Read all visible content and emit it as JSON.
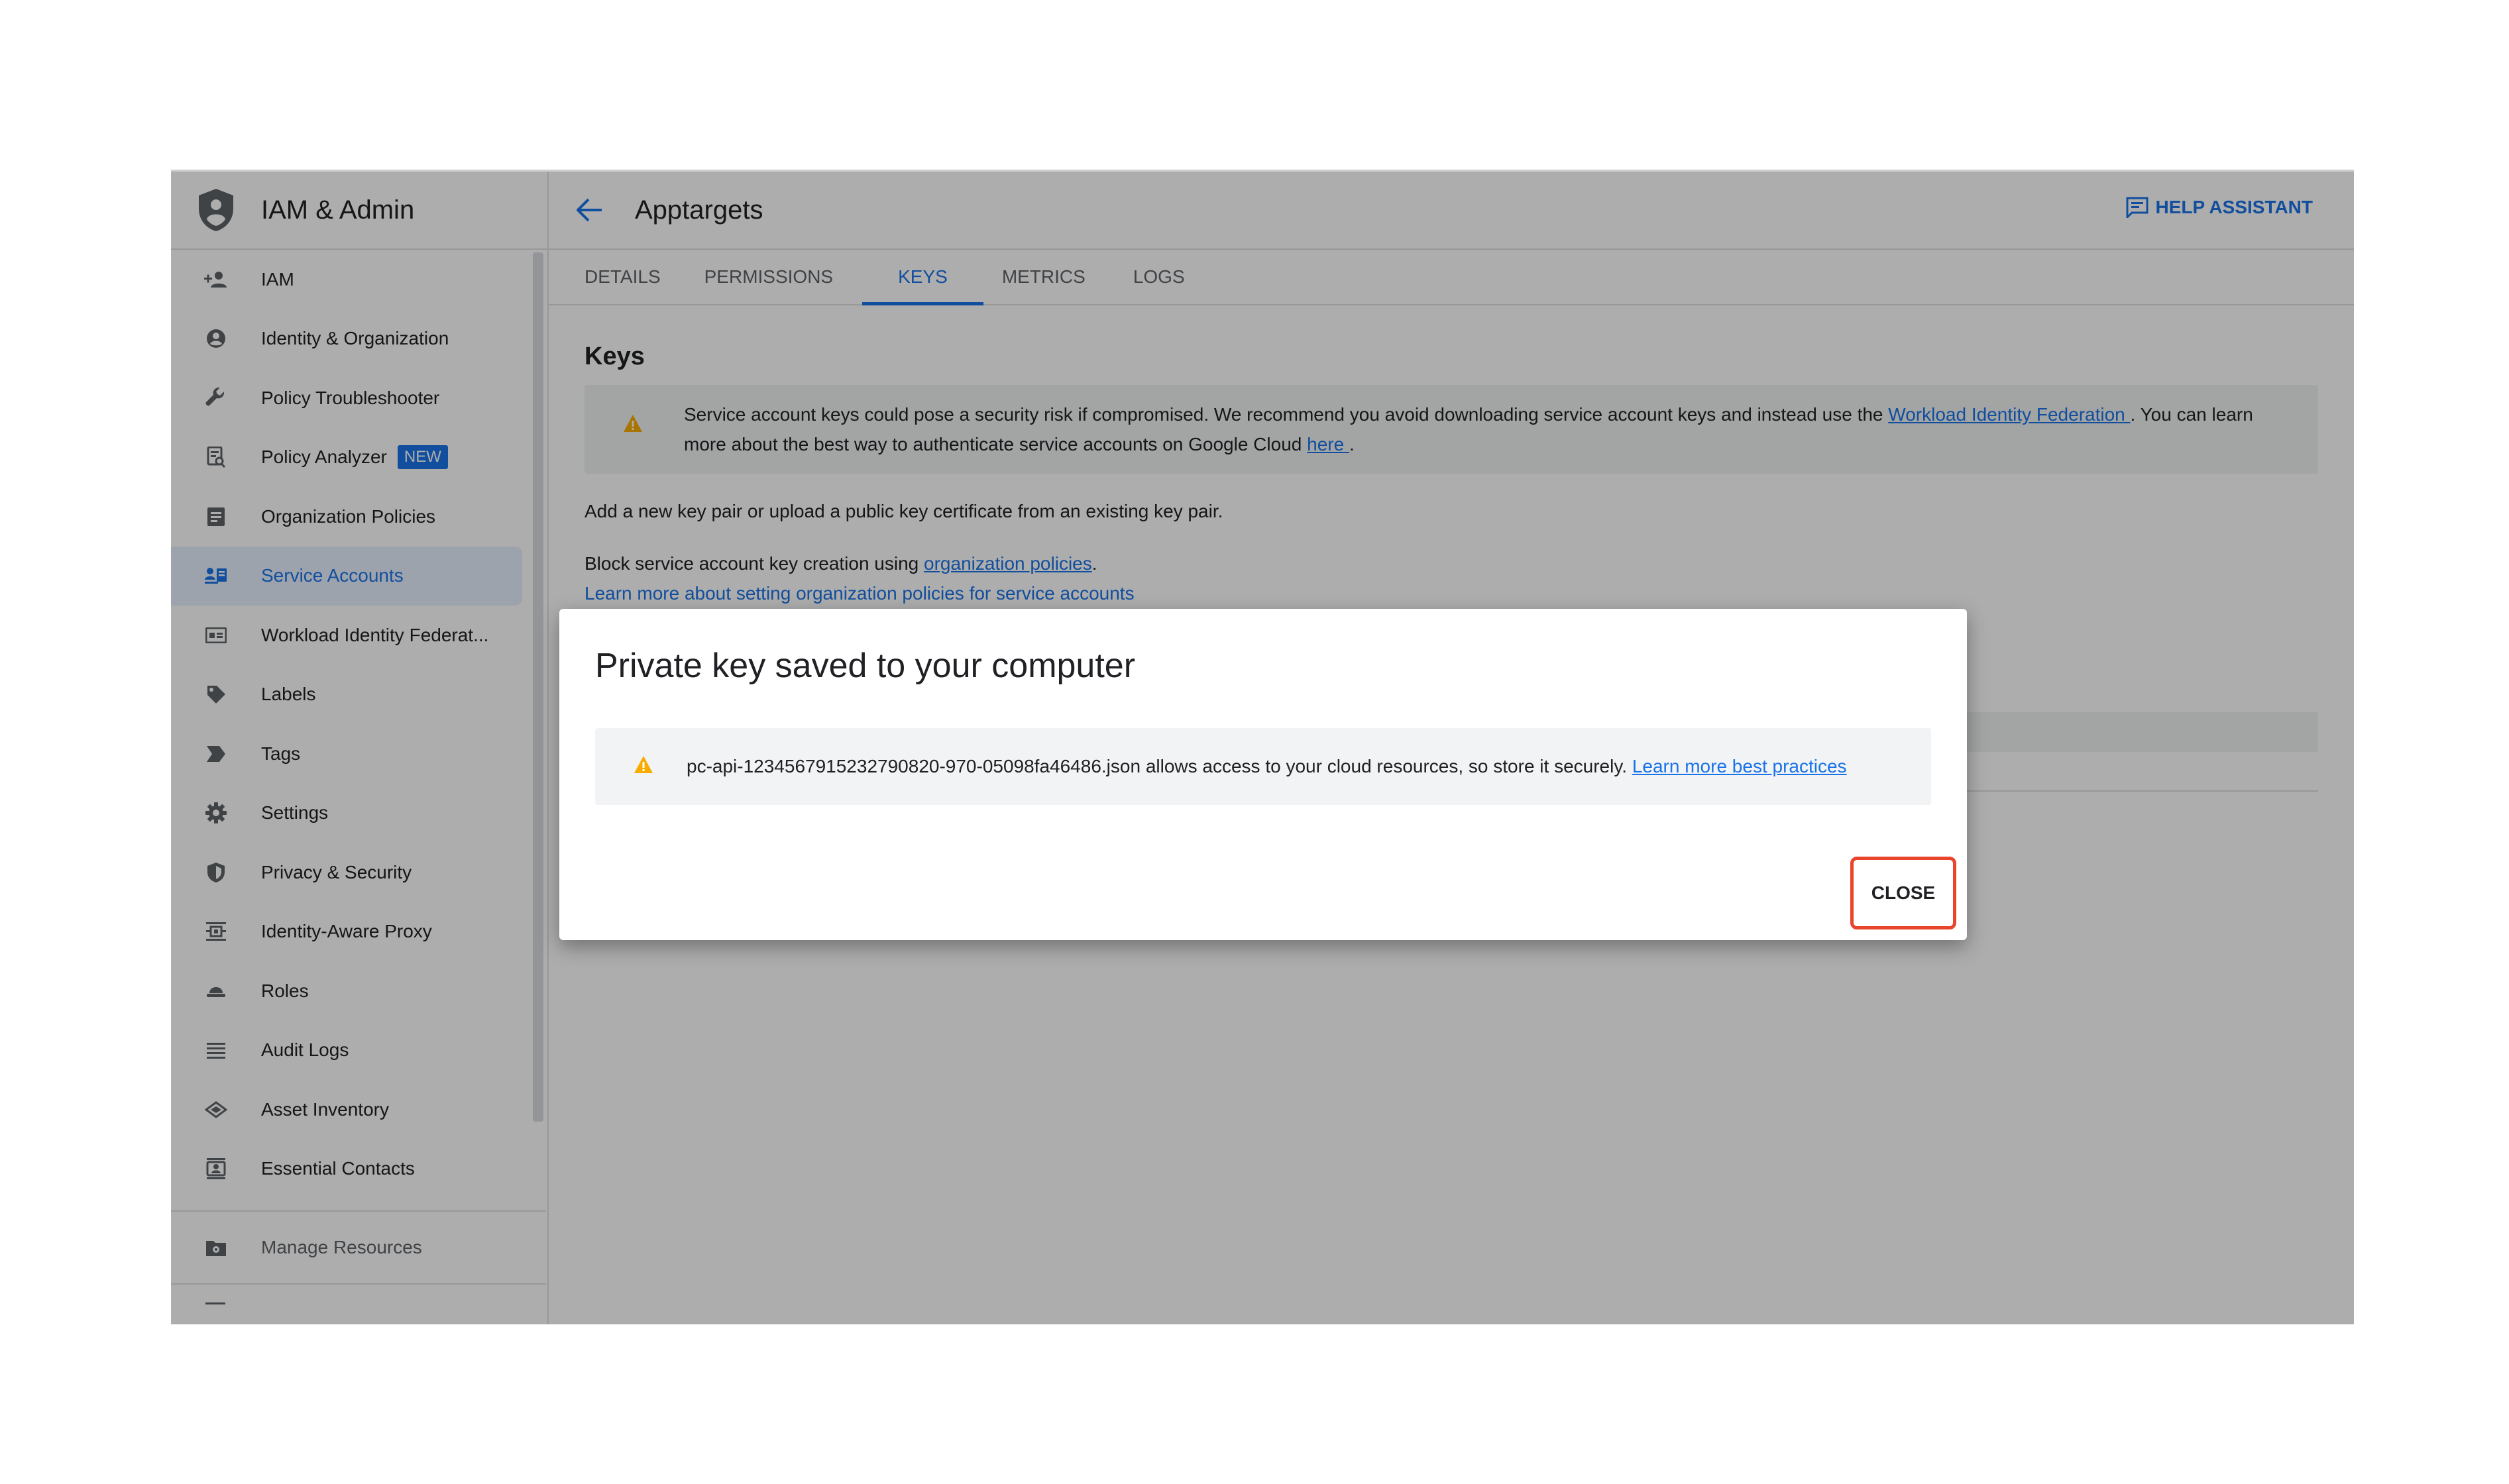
{
  "sidebar": {
    "title": "IAM & Admin",
    "items": [
      {
        "label": "IAM",
        "icon": "person-add-icon"
      },
      {
        "label": "Identity & Organization",
        "icon": "account-circle-icon"
      },
      {
        "label": "Policy Troubleshooter",
        "icon": "wrench-icon"
      },
      {
        "label": "Policy Analyzer",
        "icon": "policy-analyzer-icon",
        "badge": "NEW"
      },
      {
        "label": "Organization Policies",
        "icon": "document-icon"
      },
      {
        "label": "Service Accounts",
        "icon": "service-account-icon"
      },
      {
        "label": "Workload Identity Federat...",
        "icon": "id-card-icon"
      },
      {
        "label": "Labels",
        "icon": "label-icon"
      },
      {
        "label": "Tags",
        "icon": "tag-icon"
      },
      {
        "label": "Settings",
        "icon": "gear-icon"
      },
      {
        "label": "Privacy & Security",
        "icon": "shield-icon"
      },
      {
        "label": "Identity-Aware Proxy",
        "icon": "proxy-icon"
      },
      {
        "label": "Roles",
        "icon": "roles-icon"
      },
      {
        "label": "Audit Logs",
        "icon": "list-icon"
      },
      {
        "label": "Asset Inventory",
        "icon": "asset-icon"
      },
      {
        "label": "Essential Contacts",
        "icon": "contacts-icon"
      }
    ],
    "manage_label": "Manage Resources",
    "active_index": 5
  },
  "header": {
    "title": "Apptargets",
    "help_label": "HELP ASSISTANT"
  },
  "tabs": [
    "DETAILS",
    "PERMISSIONS",
    "KEYS",
    "METRICS",
    "LOGS"
  ],
  "active_tab": "KEYS",
  "main": {
    "section_title": "Keys",
    "warning": {
      "text1": "Service account keys could pose a security risk if compromised. We recommend you avoid downloading service account keys and instead use the ",
      "link1": "Workload Identity Federation ",
      "text2": ". You can learn more about the best way to authenticate service accounts on Google Cloud ",
      "link2": "here ",
      "text3": "."
    },
    "add_key_text": "Add a new key pair or upload a public key certificate from an existing key pair.",
    "block_text": "Block service account key creation using ",
    "block_link": "organization policies",
    "block_period": ".",
    "learn_more_link": "Learn more about setting organization policies for service accounts"
  },
  "dialog": {
    "title": "Private key saved to your computer",
    "warning_text": "pc-api-1234567915232790820-970-05098fa46486.json allows access to your cloud resources, so store it securely. ",
    "warning_link": "Learn more best practices",
    "close_label": "CLOSE"
  },
  "colors": {
    "accent": "#1a73e8",
    "warning": "#f9ab00",
    "highlight_border": "#e8452c"
  }
}
